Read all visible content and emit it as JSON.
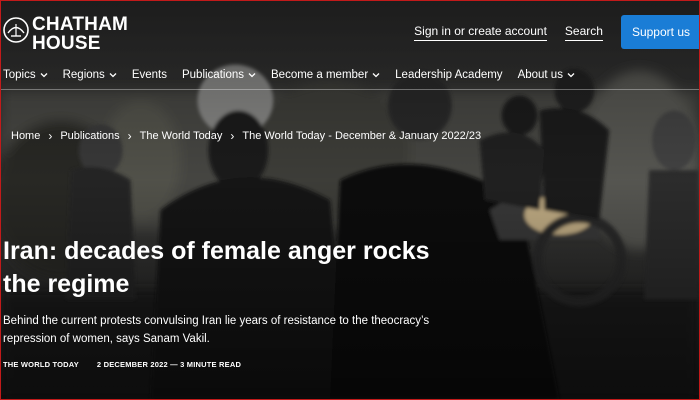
{
  "brand": {
    "line1": "CHATHAM",
    "line2": "HOUSE",
    "logo_icon": "chatham-house-emblem-icon"
  },
  "utility": {
    "signin": "Sign in or create account",
    "search": "Search",
    "support": "Support us"
  },
  "nav": [
    {
      "label": "Topics",
      "dropdown": true
    },
    {
      "label": "Regions",
      "dropdown": true
    },
    {
      "label": "Events",
      "dropdown": false
    },
    {
      "label": "Publications",
      "dropdown": true
    },
    {
      "label": "Become a member",
      "dropdown": true
    },
    {
      "label": "Leadership Academy",
      "dropdown": false
    },
    {
      "label": "About us",
      "dropdown": true
    }
  ],
  "breadcrumb": [
    "Home",
    "Publications",
    "The World Today",
    "The World Today - December & January 2022/23"
  ],
  "article": {
    "title": "Iran: decades of female anger rocks the regime",
    "standfirst": "Behind the current protests convulsing Iran lie years of resistance to the theocracy’s repression of women, says Sanam Vakil.",
    "section": "THE WORLD TODAY",
    "date_read": "2 DECEMBER 2022 — 3 MINUTE READ"
  },
  "colors": {
    "support_button": "#1a7dd6",
    "frame_border": "#c21a1a"
  }
}
